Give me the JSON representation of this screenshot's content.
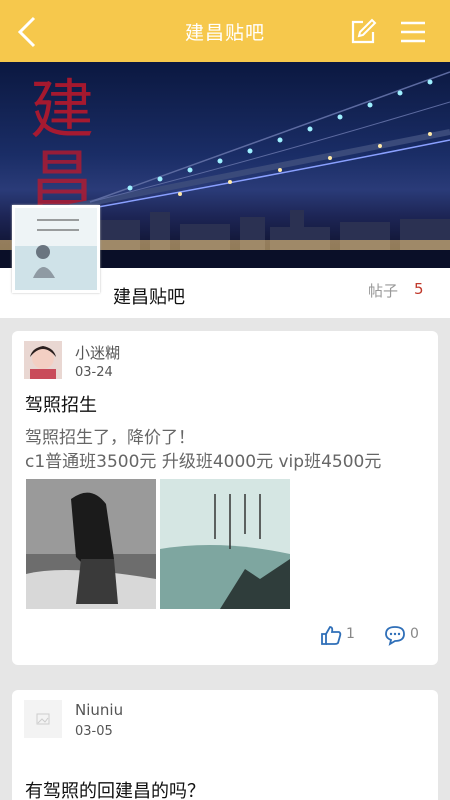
{
  "header": {
    "title": "建昌贴吧",
    "back_icon": "chevron-left-icon",
    "edit_icon": "edit-icon",
    "menu_icon": "menu-icon"
  },
  "forum": {
    "name": "建昌贴吧",
    "posts_label": "帖子",
    "posts_count": "5"
  },
  "posts": [
    {
      "author": "小迷糊",
      "date": "03-24",
      "title": "驾照招生",
      "body_lines": [
        "驾照招生了，降价了！",
        "c1普通班3500元  升级班4000元  vip班4500元"
      ],
      "likes": "1",
      "comments": "0"
    },
    {
      "author": "Niuniu",
      "date": "03-05",
      "title": "有驾照的回建昌的吗？"
    }
  ],
  "colors": {
    "header_bg": "#f6c84c",
    "count_red": "#c0392b",
    "action_blue": "#2f6fb8"
  }
}
